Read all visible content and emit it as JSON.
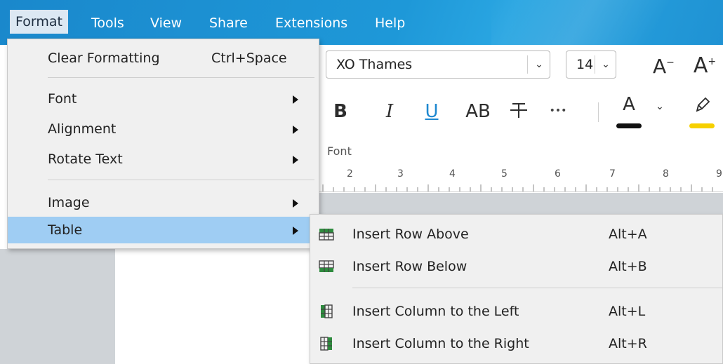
{
  "menubar": {
    "items": [
      {
        "label": "Format"
      },
      {
        "label": "Tools"
      },
      {
        "label": "View"
      },
      {
        "label": "Share"
      },
      {
        "label": "Extensions"
      },
      {
        "label": "Help"
      }
    ],
    "active": "Format"
  },
  "toolbar": {
    "font_name": "XO Thames",
    "font_size": "14",
    "grow_font": "A",
    "shrink_font": "A",
    "bold": "B",
    "italic": "I",
    "underline": "U",
    "all_caps": "AB",
    "more": "•••",
    "font_color_letter": "A",
    "font_color": "#111111",
    "highlight_color": "#f6d000",
    "section_label": "Font"
  },
  "ruler": {
    "numbers": [
      "2",
      "3",
      "4",
      "5",
      "6",
      "7",
      "8",
      "9"
    ]
  },
  "format_menu": {
    "items": [
      {
        "label": "Clear Formatting",
        "shortcut": "Ctrl+Space"
      },
      {
        "label": "Font"
      },
      {
        "label": "Alignment"
      },
      {
        "label": "Rotate Text"
      },
      {
        "label": "Image"
      },
      {
        "label": "Table"
      }
    ],
    "selected": "Table"
  },
  "table_submenu": {
    "items": [
      {
        "label": "Insert Row Above",
        "shortcut": "Alt+A",
        "icon": "insert-row-above-icon"
      },
      {
        "label": "Insert Row Below",
        "shortcut": "Alt+B",
        "icon": "insert-row-below-icon"
      },
      {
        "label": "Insert Column to the Left",
        "shortcut": "Alt+L",
        "icon": "insert-column-left-icon"
      },
      {
        "label": "Insert Column to the Right",
        "shortcut": "Alt+R",
        "icon": "insert-column-right-icon"
      }
    ]
  },
  "colors": {
    "menubar": "#1e98d8",
    "selected_item": "#9fcdf3",
    "icon_green": "#2e8b3e"
  }
}
